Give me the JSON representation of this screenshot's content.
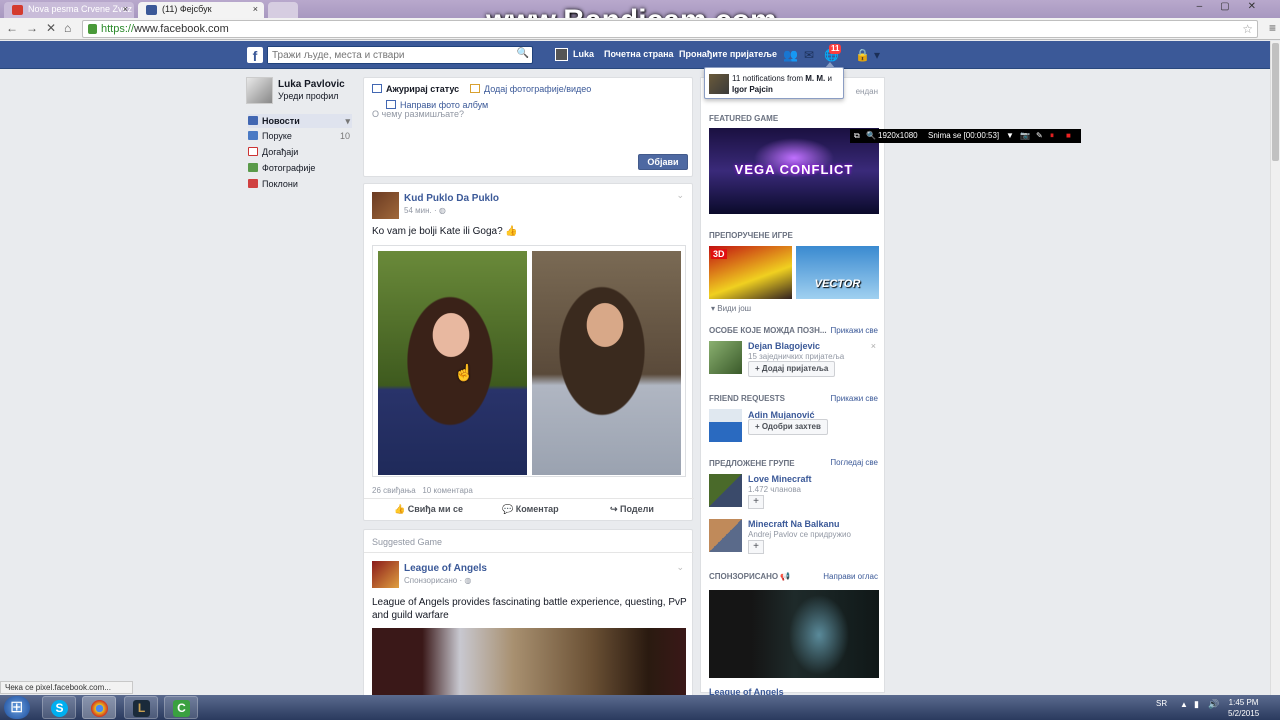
{
  "browser": {
    "tabs": [
      {
        "label": "Nova pesma Crvene Zvez",
        "close": "×"
      },
      {
        "label": "(11) Фејсбук",
        "close": "×"
      }
    ],
    "url_scheme": "https://",
    "url_rest": "www.facebook.com",
    "status_text": "Чека се pixel.facebook.com..."
  },
  "watermark": "www.Bandicam.com",
  "bandicam": {
    "resolution": "1920x1080",
    "recording": "Snima se [00:00:53]"
  },
  "header": {
    "logo": "f",
    "search_placeholder": "Тражи људе, места и ствари",
    "user": "Luka",
    "home": "Почетна страна",
    "find_friends": "Пронађите пријатеље",
    "notif_count": "11"
  },
  "notification_popup": {
    "prefix": "11 notifications from ",
    "name1": "M. M.",
    "mid": " и ",
    "name2": "Igor Pajcin"
  },
  "left_nav": {
    "name": "Luka Pavlovic",
    "edit_profile": "Уреди профил",
    "items": [
      {
        "label": "Новости",
        "icon": "news-icon",
        "count": "▾"
      },
      {
        "label": "Поруке",
        "icon": "messages-icon",
        "count": "10"
      },
      {
        "label": "Догађаји",
        "icon": "events-icon",
        "count": ""
      },
      {
        "label": "Фотографије",
        "icon": "photos-icon",
        "count": ""
      },
      {
        "label": "Поклони",
        "icon": "gift-icon",
        "count": ""
      }
    ]
  },
  "composer": {
    "update_status": "Ажурирај статус",
    "add_photos": "Додај фотографије/видео",
    "make_album": "Направи фото албум",
    "placeholder": "О чему размишљате?",
    "post_button": "Објави"
  },
  "post1": {
    "author": "Kud Puklo Da Puklo",
    "time": "54 мин. · ",
    "text": "Ko vam je bolji Kate ili Goga?",
    "stats": "26 свиђања   10 коментара",
    "like": "Свиђа ми се",
    "comment": "Коментар",
    "share": "Подели"
  },
  "post2": {
    "label": "Suggested Game",
    "author": "League of Angels",
    "sub": "Спонзорисано · ",
    "text": "League of Angels provides fascinating battle experience, questing, PvP and guild warfare"
  },
  "right_col": {
    "sponsored_hidden": "ендан",
    "featured_game": "FEATURED GAME",
    "featured_title": "VEGA CONFLICT",
    "recommended_games": "ПРЕПОРУЧЕНЕ ИГРЕ",
    "game1_badge": "3D",
    "game2_title": "VECTOR",
    "see_more": "Види још",
    "people_heading": "ОСОБЕ КОЈЕ МОЖДА ПОЗН...",
    "see_all": "Прикажи све",
    "person1_name": "Dejan Blagojevic",
    "person1_mutual": "15 заједничких пријатеља",
    "add_friend": "Додај пријатеља",
    "friend_requests": "FRIEND REQUESTS",
    "see_all2": "Прикажи све",
    "person2_name": "Adin Mujanović",
    "approve": "Одобри захтев",
    "groups_heading": "ПРЕДЛОЖЕНЕ ГРУПЕ",
    "see_all3": "Погледај све",
    "group1_name": "Love Minecraft",
    "group1_members": "1.472 чланова",
    "group2_name": "Minecraft Na Balkanu",
    "group2_sub": "Andrej Pavlov се придружио",
    "plus": "+",
    "sponsored": "СПОНЗОРИСАНО",
    "create_ad": "Направи оглас",
    "ad_title": "League of Angels"
  },
  "taskbar": {
    "lang": "SR",
    "time": "1:45 PM",
    "date": "5/2/2015"
  },
  "colors": {
    "fb_blue": "#3b5998",
    "badge_red": "#fa3e3e"
  }
}
